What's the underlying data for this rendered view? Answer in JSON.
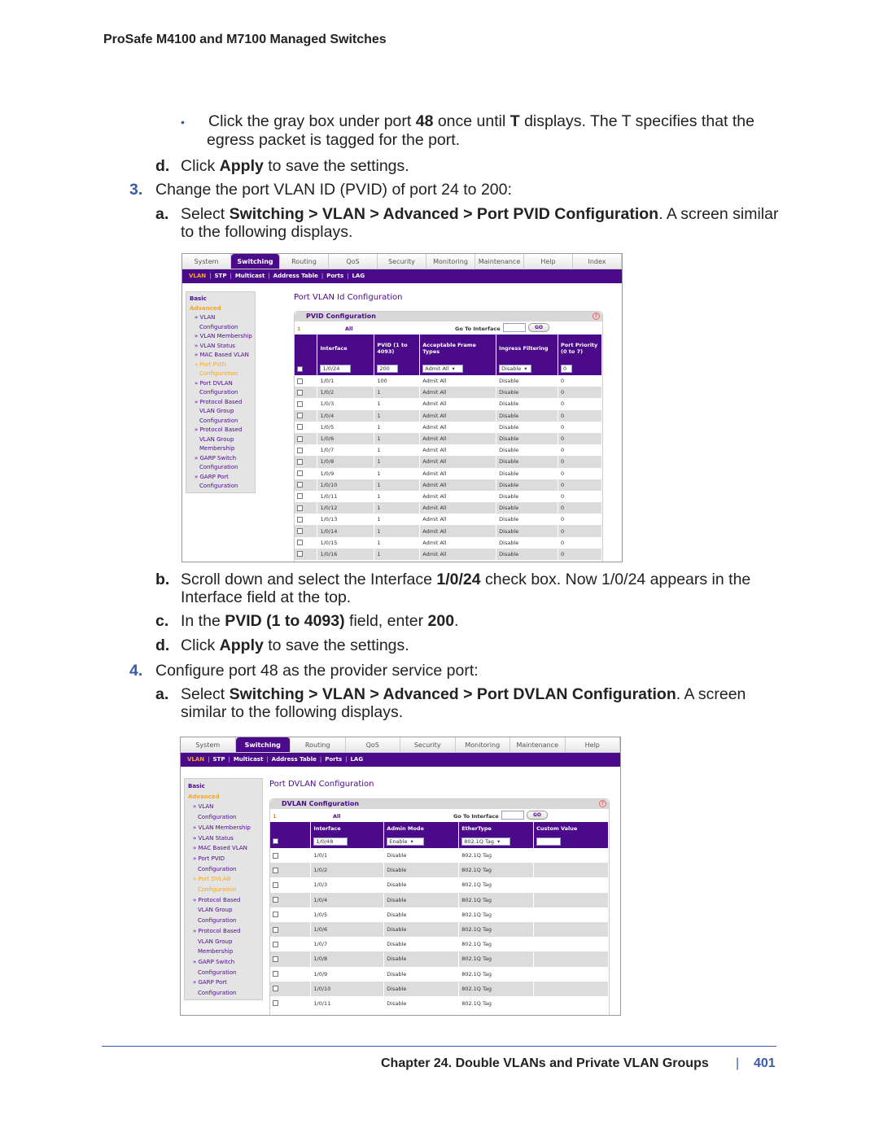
{
  "header": {
    "title": "ProSafe M4100 and M7100 Managed Switches"
  },
  "steps": {
    "bullet": {
      "glyph": "•",
      "line1_pre": "Click the gray box under port ",
      "line1_b1": "48",
      "line1_mid": " once until ",
      "line1_b2": "T",
      "line1_post": " displays. The T specifies that the",
      "line2": "egress packet is tagged for the port."
    },
    "d1": {
      "letter": "d.",
      "pre": "Click ",
      "b": "Apply",
      "post": " to save the settings."
    },
    "s3": {
      "num": "3.",
      "text": "Change the port VLAN ID (PVID) of port 24 to 200:"
    },
    "a1": {
      "letter": "a.",
      "pre": "Select ",
      "b1": "Switching > VLAN > Advanced > Port PVID Configuration",
      "post": ". A screen similar",
      "line2": "to the following displays."
    },
    "b1": {
      "letter": "b.",
      "pre": "Scroll down and select the Interface ",
      "b": "1/0/24",
      "post": " check box. Now 1/0/24 appears in the",
      "line2": "Interface field at the top."
    },
    "c1": {
      "letter": "c.",
      "pre": "In the ",
      "b1": "PVID (1 to 4093)",
      "mid": " field, enter ",
      "b2": "200",
      "post": "."
    },
    "d2": {
      "letter": "d.",
      "pre": "Click ",
      "b": "Apply",
      "post": " to save the settings."
    },
    "s4": {
      "num": "4.",
      "text": "Configure port 48 as the provider service port:"
    },
    "a2": {
      "letter": "a.",
      "pre": "Select ",
      "b1": "Switching > VLAN > Advanced > Port DVLAN Configuration",
      "post": ". A screen",
      "line2": "similar to the following displays."
    }
  },
  "shot1": {
    "tabs": [
      "System",
      "Switching",
      "Routing",
      "QoS",
      "Security",
      "Monitoring",
      "Maintenance",
      "Help",
      "Index"
    ],
    "active_tab": "Switching",
    "subnav": [
      "VLAN",
      "STP",
      "Multicast",
      "Address Table",
      "Ports",
      "LAG"
    ],
    "sidebar": [
      {
        "t": "Basic",
        "c": "h"
      },
      {
        "t": "Advanced",
        "c": "h on"
      },
      {
        "t": "» VLAN",
        "c": "it"
      },
      {
        "t": "Configuration",
        "c": "ind"
      },
      {
        "t": "» VLAN Membership",
        "c": "it"
      },
      {
        "t": "» VLAN Status",
        "c": "it"
      },
      {
        "t": "» MAC Based VLAN",
        "c": "it"
      },
      {
        "t": "» Port PVID",
        "c": "it on"
      },
      {
        "t": "Configuration",
        "c": "ind on"
      },
      {
        "t": "» Port DVLAN",
        "c": "it"
      },
      {
        "t": "Configuration",
        "c": "ind"
      },
      {
        "t": "» Protocol Based",
        "c": "it"
      },
      {
        "t": "VLAN Group",
        "c": "ind"
      },
      {
        "t": "Configuration",
        "c": "ind"
      },
      {
        "t": "» Protocol Based",
        "c": "it"
      },
      {
        "t": "VLAN Group",
        "c": "ind"
      },
      {
        "t": "Membership",
        "c": "ind"
      },
      {
        "t": "» GARP Switch",
        "c": "it"
      },
      {
        "t": "Configuration",
        "c": "ind"
      },
      {
        "t": "» GARP Port",
        "c": "it"
      },
      {
        "t": "Configuration",
        "c": "ind"
      }
    ],
    "page_title": "Port VLAN Id Configuration",
    "panel_title": "PVID Configuration",
    "page_num": "1",
    "all": "All",
    "goto": "Go To Interface",
    "go": "GO",
    "columns": [
      "",
      "Interface",
      "PVID (1 to 4093)",
      "Acceptable Frame Types",
      "Ingress Filtering",
      "Port Priority (0 to 7)"
    ],
    "input": [
      "1/0/24",
      "200",
      "Admit All",
      "Disable",
      "0"
    ],
    "rows": [
      [
        "1/0/1",
        "100",
        "Admit All",
        "Disable",
        "0"
      ],
      [
        "1/0/2",
        "1",
        "Admit All",
        "Disable",
        "0"
      ],
      [
        "1/0/3",
        "1",
        "Admit All",
        "Disable",
        "0"
      ],
      [
        "1/0/4",
        "1",
        "Admit All",
        "Disable",
        "0"
      ],
      [
        "1/0/5",
        "1",
        "Admit All",
        "Disable",
        "0"
      ],
      [
        "1/0/6",
        "1",
        "Admit All",
        "Disable",
        "0"
      ],
      [
        "1/0/7",
        "1",
        "Admit All",
        "Disable",
        "0"
      ],
      [
        "1/0/8",
        "1",
        "Admit All",
        "Disable",
        "0"
      ],
      [
        "1/0/9",
        "1",
        "Admit All",
        "Disable",
        "0"
      ],
      [
        "1/0/10",
        "1",
        "Admit All",
        "Disable",
        "0"
      ],
      [
        "1/0/11",
        "1",
        "Admit All",
        "Disable",
        "0"
      ],
      [
        "1/0/12",
        "1",
        "Admit All",
        "Disable",
        "0"
      ],
      [
        "1/0/13",
        "1",
        "Admit All",
        "Disable",
        "0"
      ],
      [
        "1/0/14",
        "1",
        "Admit All",
        "Disable",
        "0"
      ],
      [
        "1/0/15",
        "1",
        "Admit All",
        "Disable",
        "0"
      ],
      [
        "1/0/16",
        "1",
        "Admit All",
        "Disable",
        "0"
      ]
    ]
  },
  "shot2": {
    "tabs": [
      "System",
      "Switching",
      "Routing",
      "QoS",
      "Security",
      "Monitoring",
      "Maintenance",
      "Help"
    ],
    "active_tab": "Switching",
    "subnav": [
      "VLAN",
      "STP",
      "Multicast",
      "Address Table",
      "Ports",
      "LAG"
    ],
    "sidebar": [
      {
        "t": "Basic",
        "c": "h"
      },
      {
        "t": "Advanced",
        "c": "h on"
      },
      {
        "t": "» VLAN",
        "c": "it"
      },
      {
        "t": "Configuration",
        "c": "ind"
      },
      {
        "t": "» VLAN Membership",
        "c": "it"
      },
      {
        "t": "» VLAN Status",
        "c": "it"
      },
      {
        "t": "» MAC Based VLAN",
        "c": "it"
      },
      {
        "t": "» Port PVID",
        "c": "it"
      },
      {
        "t": "Configuration",
        "c": "ind"
      },
      {
        "t": "» Port DVLAN",
        "c": "it on"
      },
      {
        "t": "Configuration",
        "c": "ind on"
      },
      {
        "t": "» Protocol Based",
        "c": "it"
      },
      {
        "t": "VLAN Group",
        "c": "ind"
      },
      {
        "t": "Configuration",
        "c": "ind"
      },
      {
        "t": "» Protocol Based",
        "c": "it"
      },
      {
        "t": "VLAN Group",
        "c": "ind"
      },
      {
        "t": "Membership",
        "c": "ind"
      },
      {
        "t": "» GARP Switch",
        "c": "it"
      },
      {
        "t": "Configuration",
        "c": "ind"
      },
      {
        "t": "» GARP Port",
        "c": "it"
      },
      {
        "t": "Configuration",
        "c": "ind"
      }
    ],
    "page_title": "Port DVLAN Configuration",
    "panel_title": "DVLAN Configuration",
    "page_num": "1",
    "all": "All",
    "goto": "Go To Interface",
    "go": "GO",
    "columns": [
      "",
      "Interface",
      "Admin Mode",
      "EtherType",
      "Custom Value"
    ],
    "input": [
      "1/0/48",
      "Enable",
      "802.1Q Tag",
      ""
    ],
    "rows": [
      [
        "1/0/1",
        "Disable",
        "802.1Q Tag",
        ""
      ],
      [
        "1/0/2",
        "Disable",
        "802.1Q Tag",
        ""
      ],
      [
        "1/0/3",
        "Disable",
        "802.1Q Tag",
        ""
      ],
      [
        "1/0/4",
        "Disable",
        "802.1Q Tag",
        ""
      ],
      [
        "1/0/5",
        "Disable",
        "802.1Q Tag",
        ""
      ],
      [
        "1/0/6",
        "Disable",
        "802.1Q Tag",
        ""
      ],
      [
        "1/0/7",
        "Disable",
        "802.1Q Tag",
        ""
      ],
      [
        "1/0/8",
        "Disable",
        "802.1Q Tag",
        ""
      ],
      [
        "1/0/9",
        "Disable",
        "802.1Q Tag",
        ""
      ],
      [
        "1/0/10",
        "Disable",
        "802.1Q Tag",
        ""
      ],
      [
        "1/0/11",
        "Disable",
        "802.1Q Tag",
        ""
      ]
    ]
  },
  "footer": {
    "chapter": "Chapter 24.  Double VLANs and Private VLAN Groups",
    "separator": "|",
    "page": "401"
  },
  "colors": {
    "brand_purple": "#4b0a8a",
    "accent_orange": "#f5a623",
    "link_blue": "#3a5ba8"
  }
}
